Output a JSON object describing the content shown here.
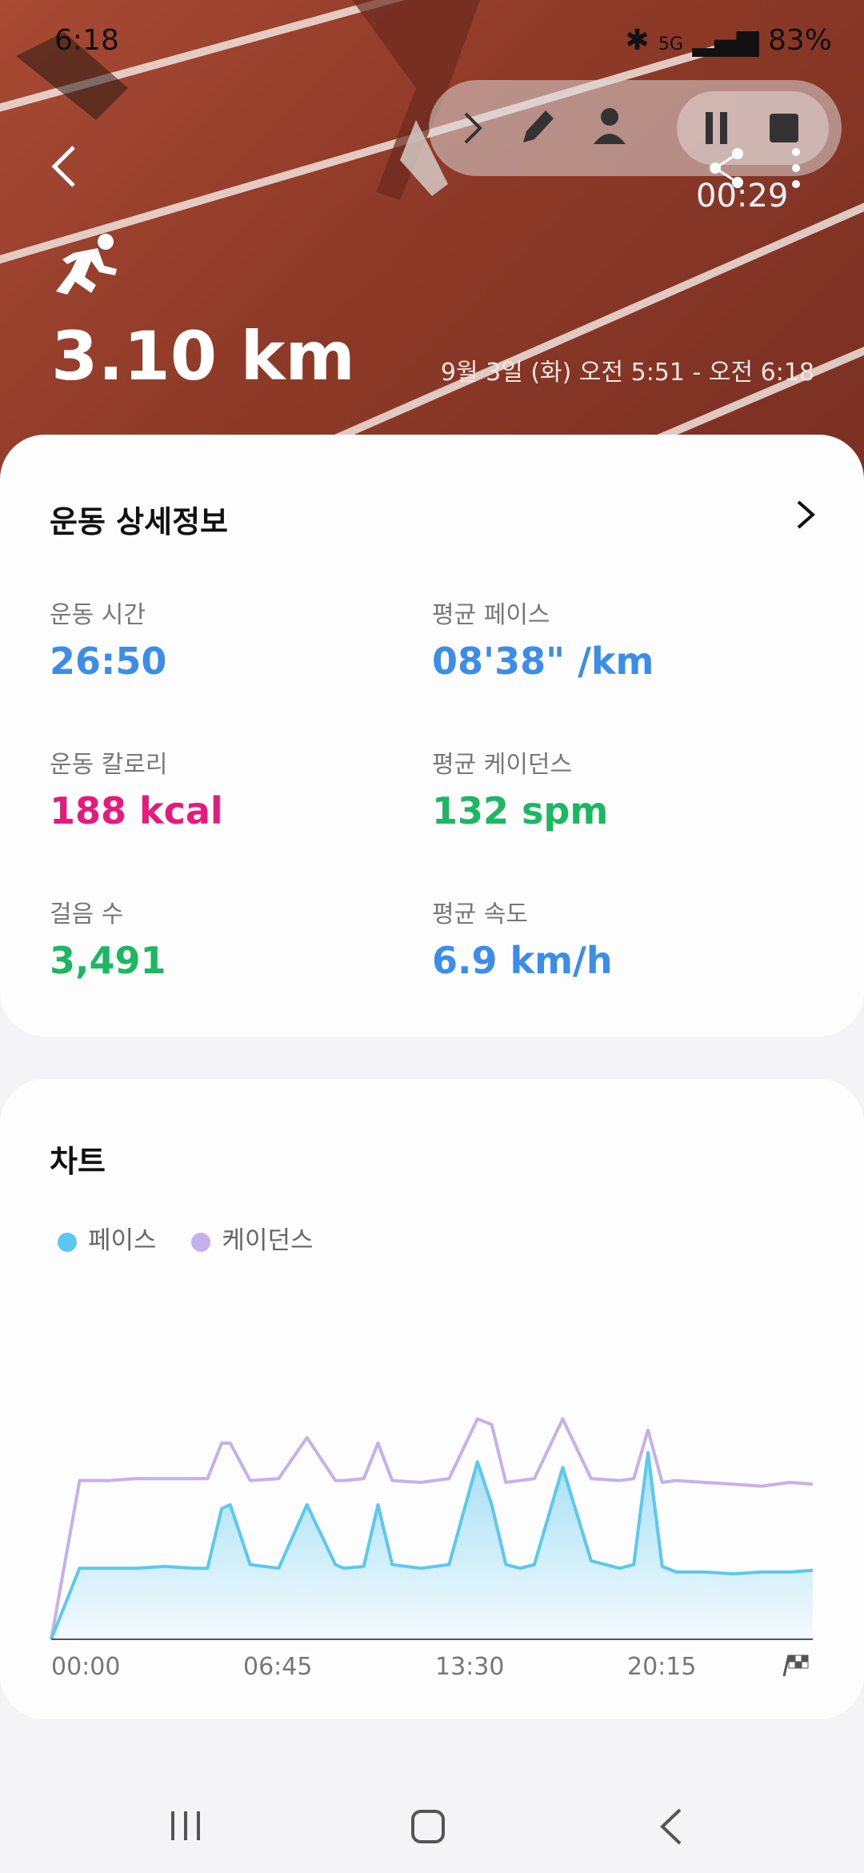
{
  "status_bar": {
    "time": "6:18",
    "battery": "83%",
    "network": "5G"
  },
  "recording": {
    "timer": "00:29"
  },
  "hero": {
    "distance": "3.10 km",
    "date_range": "9월 3일 (화) 오전 5:51 - 오전 6:18"
  },
  "details": {
    "title": "운동 상세정보",
    "metrics": [
      {
        "label": "운동 시간",
        "value": "26:50",
        "color": "#3b8de8"
      },
      {
        "label": "평균 페이스",
        "value": "08'38\" /km",
        "color": "#3b8de8"
      },
      {
        "label": "운동 칼로리",
        "value": "188 kcal",
        "color": "#e8197c"
      },
      {
        "label": "평균 케이던스",
        "value": "132 spm",
        "color": "#1bb761"
      },
      {
        "label": "걸음 수",
        "value": "3,491",
        "color": "#1bb761"
      },
      {
        "label": "평균 속도",
        "value": "6.9 km/h",
        "color": "#3b8de8"
      }
    ]
  },
  "chart_section": {
    "title": "차트",
    "legend": [
      "페이스",
      "케이던스"
    ],
    "colors": {
      "pace": "#5bc8ef",
      "cadence": "#c3b1ee"
    }
  },
  "chart_data": {
    "type": "line",
    "x": [
      0,
      1,
      2,
      3,
      4,
      5,
      5.5,
      6,
      6.3,
      7,
      8,
      9,
      10,
      10.3,
      11,
      11.5,
      12,
      13,
      14,
      15,
      15.5,
      16,
      16.5,
      17,
      18,
      19,
      20,
      20.5,
      21,
      21.5,
      22,
      23,
      24,
      25,
      26,
      26.8
    ],
    "x_tick_labels": [
      "00:00",
      "06:45",
      "13:30",
      "20:15"
    ],
    "series": [
      {
        "name": "페이스",
        "values": [
          0,
          0.38,
          0.38,
          0.38,
          0.39,
          0.38,
          0.38,
          0.7,
          0.72,
          0.4,
          0.38,
          0.72,
          0.4,
          0.38,
          0.39,
          0.72,
          0.4,
          0.38,
          0.4,
          0.95,
          0.72,
          0.4,
          0.38,
          0.4,
          0.92,
          0.42,
          0.38,
          0.4,
          1.0,
          0.39,
          0.36,
          0.36,
          0.35,
          0.36,
          0.36,
          0.37
        ]
      },
      {
        "name": "케이던스",
        "values": [
          0,
          0.85,
          0.85,
          0.86,
          0.86,
          0.86,
          0.86,
          1.05,
          1.05,
          0.85,
          0.86,
          1.08,
          0.85,
          0.85,
          0.86,
          1.05,
          0.85,
          0.84,
          0.86,
          1.18,
          1.15,
          0.84,
          0.85,
          0.86,
          1.18,
          0.86,
          0.85,
          0.86,
          1.12,
          0.84,
          0.85,
          0.84,
          0.83,
          0.82,
          0.84,
          0.83
        ]
      }
    ],
    "ylim": [
      0,
      1.2
    ]
  }
}
